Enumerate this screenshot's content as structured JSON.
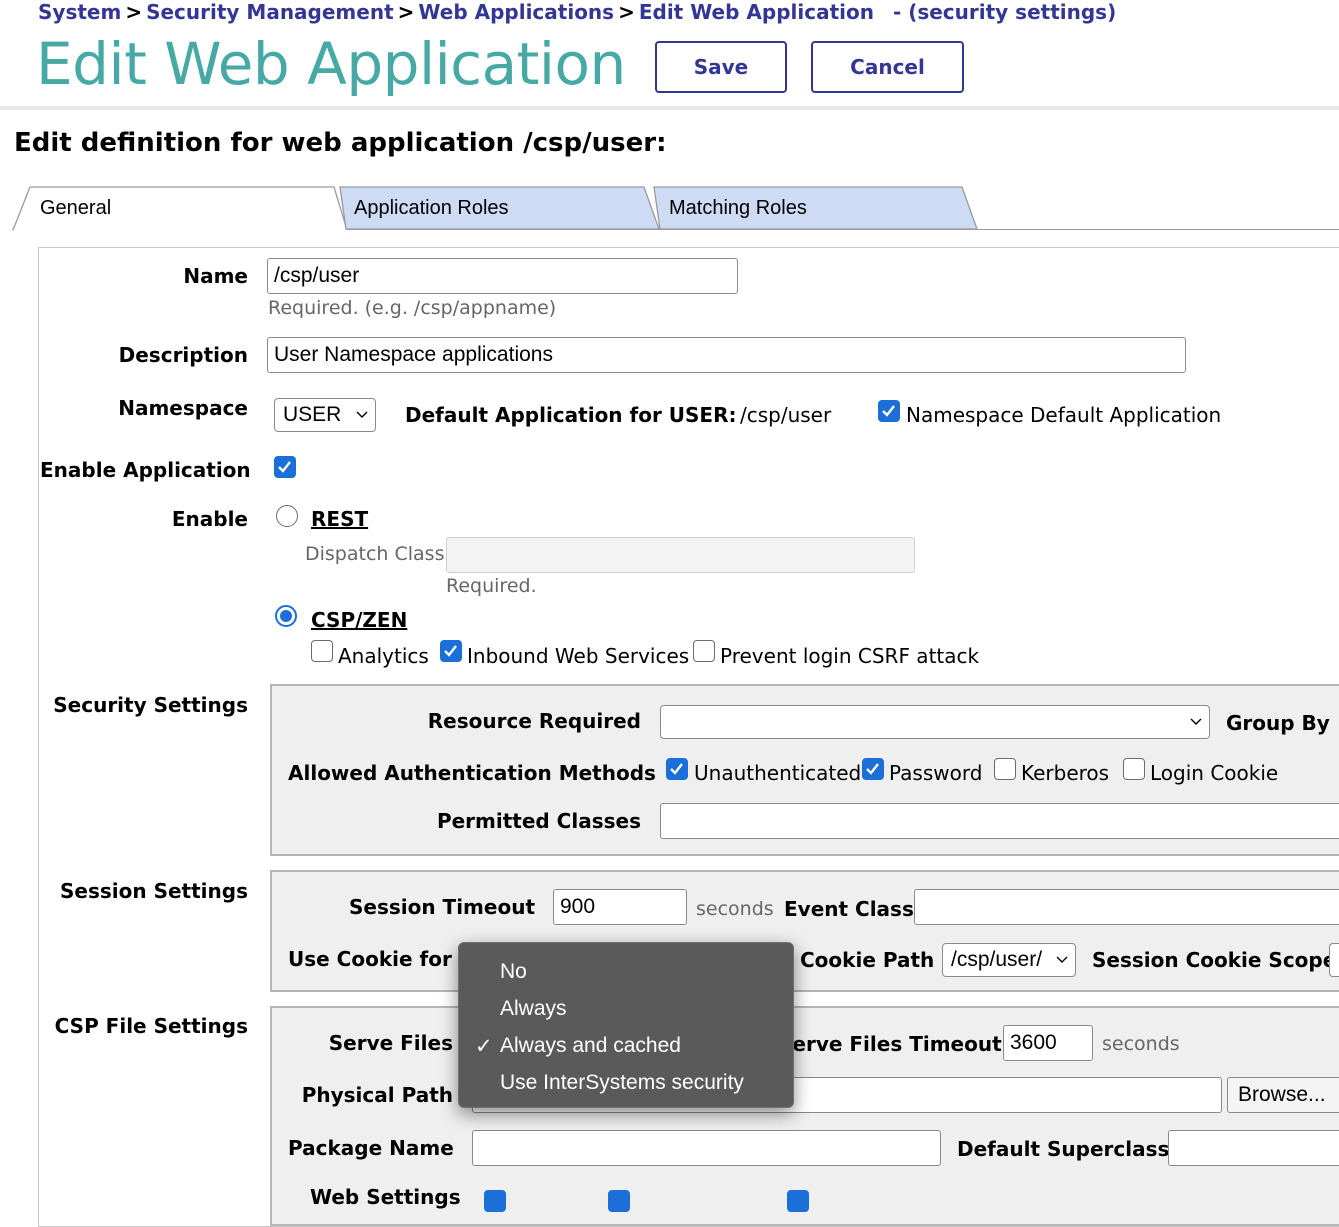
{
  "breadcrumb": {
    "items": [
      "System",
      "Security Management",
      "Web Applications",
      "Edit Web Application"
    ],
    "separator": ">",
    "suffix": "- (security settings)"
  },
  "header": {
    "title": "Edit Web Application",
    "save_label": "Save",
    "cancel_label": "Cancel"
  },
  "subtitle": "Edit definition for web application /csp/user:",
  "tabs": [
    {
      "label": "General",
      "active": true
    },
    {
      "label": "Application Roles",
      "active": false
    },
    {
      "label": "Matching Roles",
      "active": false
    }
  ],
  "general": {
    "name_label": "Name",
    "name_value": "/csp/user",
    "name_hint": "Required. (e.g. /csp/appname)",
    "description_label": "Description",
    "description_value": "User Namespace applications",
    "namespace_label": "Namespace",
    "namespace_value": "USER",
    "default_app_label": "Default Application for USER:",
    "default_app_value": "/csp/user",
    "ns_default_label": "Namespace Default Application",
    "enable_app_label": "Enable Application",
    "enable_label": "Enable",
    "rest_label": "REST",
    "dispatch_label": "Dispatch Class",
    "dispatch_hint": "Required.",
    "cspzen_label": "CSP/ZEN",
    "analytics_label": "Analytics",
    "inbound_label": "Inbound Web Services",
    "csrf_label": "Prevent login CSRF attack"
  },
  "security": {
    "section_label": "Security Settings",
    "resource_label": "Resource Required",
    "group_by_label": "Group By",
    "auth_label": "Allowed Authentication Methods",
    "unauth_label": "Unauthenticated",
    "password_label": "Password",
    "kerberos_label": "Kerberos",
    "login_cookie_label": "Login Cookie",
    "permitted_label": "Permitted Classes"
  },
  "session": {
    "section_label": "Session Settings",
    "timeout_label": "Session Timeout",
    "timeout_value": "900",
    "seconds": "seconds",
    "event_class_label": "Event Class",
    "use_cookie_label": "Use Cookie for S",
    "cookie_path_label": "Cookie Path",
    "cookie_path_value": "/csp/user/",
    "cookie_scope_label": "Session Cookie Scope"
  },
  "csp_file": {
    "section_label": "CSP File Settings",
    "serve_files_label": "Serve Files",
    "serve_timeout_label": "Serve Files Timeout",
    "serve_timeout_value": "3600",
    "seconds": "seconds",
    "physical_path_label": "Physical Path",
    "browse_label": "Browse...",
    "package_label": "Package Name",
    "superclass_label": "Default Superclass",
    "web_settings_label": "Web Settings"
  },
  "dropdown": {
    "options": [
      "No",
      "Always",
      "Always and cached",
      "Use InterSystems security"
    ],
    "selected": "Always and cached",
    "check": "✓"
  },
  "colors": {
    "title": "#47a9a3",
    "link": "#333695",
    "tab_inactive": "#cddcf4",
    "checkbox": "#1c6fd8"
  }
}
